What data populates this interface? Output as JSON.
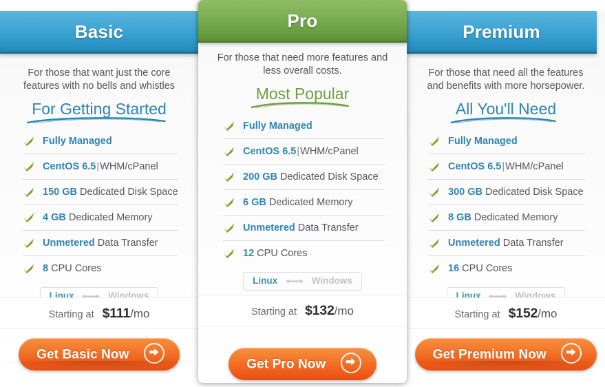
{
  "theme": {
    "blue_header": "#3fa6d3",
    "green_header": "#7aae51",
    "cta_orange": "#ef5f1c",
    "check_green": "#7ba428",
    "value_blue": "#3084b5",
    "divider": "#dcdcdc"
  },
  "labels": {
    "starting_at": "Starting at",
    "per_month": "/mo",
    "os_linux": "Linux",
    "os_windows": "Windows",
    "separator": "|"
  },
  "plans": [
    {
      "id": "basic",
      "name": "Basic",
      "tagline": "For those that want just the core features with no bells and whistles",
      "headline": "For Getting Started",
      "featured": false,
      "features": [
        {
          "value": "Fully Managed",
          "rest": ""
        },
        {
          "value": "CentOS 6.5",
          "sep": "|",
          "rest": "WHM/cPanel"
        },
        {
          "value": "150 GB",
          "rest": "Dedicated Disk Space"
        },
        {
          "value": "4 GB",
          "rest": "Dedicated Memory"
        },
        {
          "value": "Unmetered",
          "rest": "Data Transfer"
        },
        {
          "value": "8",
          "rest": "CPU Cores"
        }
      ],
      "price": "$111",
      "cta": "Get Basic Now"
    },
    {
      "id": "pro",
      "name": "Pro",
      "tagline": "For those that need more features and less overall costs.",
      "headline": "Most Popular",
      "featured": true,
      "features": [
        {
          "value": "Fully Managed",
          "rest": ""
        },
        {
          "value": "CentOS 6.5",
          "sep": "|",
          "rest": "WHM/cPanel"
        },
        {
          "value": "200 GB",
          "rest": "Dedicated Disk Space"
        },
        {
          "value": "6 GB",
          "rest": "Dedicated Memory"
        },
        {
          "value": "Unmetered",
          "rest": "Data Transfer"
        },
        {
          "value": "12",
          "rest": "CPU Cores"
        }
      ],
      "price": "$132",
      "cta": "Get Pro Now"
    },
    {
      "id": "premium",
      "name": "Premium",
      "tagline": "For those that need all the features and benefits with more horsepower.",
      "headline": "All You'll Need",
      "featured": false,
      "features": [
        {
          "value": "Fully Managed",
          "rest": ""
        },
        {
          "value": "CentOS 6.5",
          "sep": "|",
          "rest": "WHM/cPanel"
        },
        {
          "value": "300 GB",
          "rest": "Dedicated Disk Space"
        },
        {
          "value": "8 GB",
          "rest": "Dedicated Memory"
        },
        {
          "value": "Unmetered",
          "rest": "Data Transfer"
        },
        {
          "value": "16",
          "rest": "CPU Cores"
        }
      ],
      "price": "$152",
      "cta": "Get Premium Now"
    }
  ]
}
